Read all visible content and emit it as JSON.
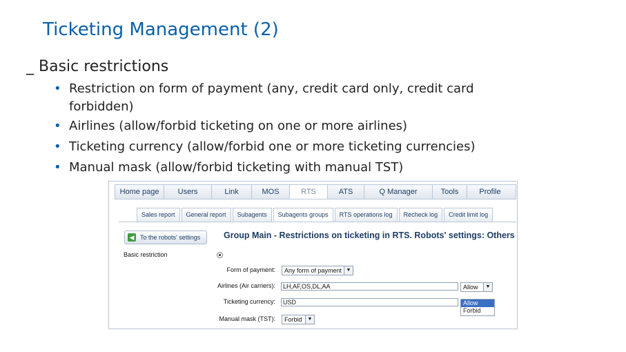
{
  "slide": {
    "title": "Ticketing Management (2)",
    "subhead": "_ Basic restrictions",
    "bullets": [
      "Restriction on form of payment (any, credit card only, credit card forbidden)",
      "Airlines  (allow/forbid ticketing on one or more airlines)",
      "Ticketing currency (allow/forbid one or more ticketing currencies)",
      "Manual mask (allow/forbid ticketing with manual TST)"
    ],
    "bullet_glyph": "•",
    "title_color": "#0a5fa8"
  },
  "app": {
    "nav_tabs": [
      "Home page",
      "Users",
      "Link",
      "MOS",
      "RTS",
      "ATS",
      "Q Manager",
      "Tools",
      "Profile"
    ],
    "active_nav": "RTS",
    "sub_tabs": [
      "Sales report",
      "General report",
      "Subagents",
      "Subagents groups",
      "RTS operations log",
      "Recheck log",
      "Credit limit log"
    ],
    "active_sub": "Subagents groups",
    "back_button": "To the robots' settings",
    "back_icon": "back-arrow-icon",
    "heading": "Group Main - Restrictions on ticketing in RTS. Robots' settings: Others",
    "basic_restriction_label": "Basic restriction",
    "form_of_payment": {
      "label": "Form of payment:",
      "value": "Any form of payment"
    },
    "airlines": {
      "label": "Airlines (Air carriers):",
      "value": "LH,AF,OS,DL,AA",
      "mode": "Allow"
    },
    "ticketing_currency": {
      "label": "Ticketing currency:",
      "value": "USD",
      "options": [
        "Allow",
        "Forbid"
      ],
      "selected": "Allow"
    },
    "manual_mask": {
      "label": "Manual mask (TST):",
      "value": "Forbid"
    },
    "accent_color": "#1d3d63"
  }
}
